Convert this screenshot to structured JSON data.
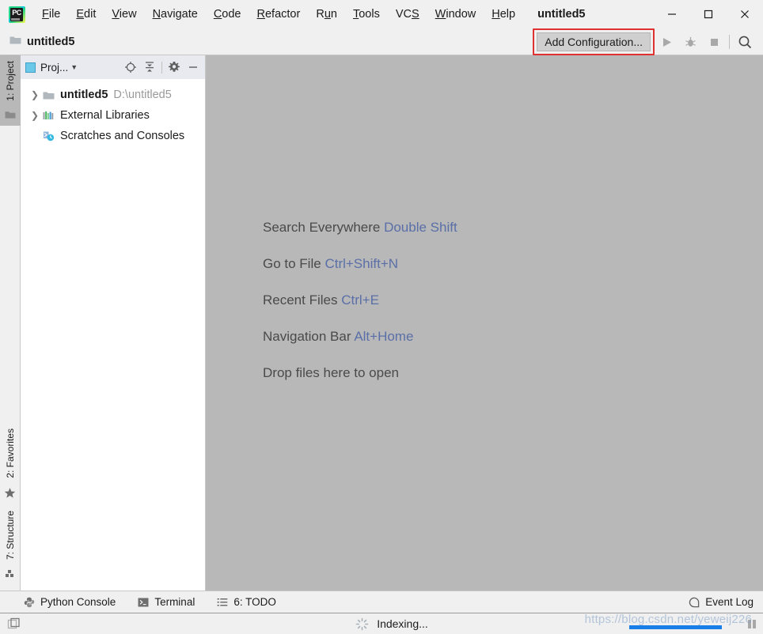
{
  "window": {
    "title": "untitled5",
    "logo_text": "PC",
    "controls": [
      {
        "name": "minimize",
        "glyph": "minimize-icon"
      },
      {
        "name": "maximize",
        "glyph": "maximize-icon"
      },
      {
        "name": "close",
        "glyph": "close-icon"
      }
    ]
  },
  "menu": [
    {
      "label": "File",
      "mnemonic": "F"
    },
    {
      "label": "Edit",
      "mnemonic": "E"
    },
    {
      "label": "View",
      "mnemonic": "V"
    },
    {
      "label": "Navigate",
      "mnemonic": "N"
    },
    {
      "label": "Code",
      "mnemonic": "C"
    },
    {
      "label": "Refactor",
      "mnemonic": "R"
    },
    {
      "label": "Run",
      "mnemonic": "u"
    },
    {
      "label": "Tools",
      "mnemonic": "T"
    },
    {
      "label": "VCS",
      "mnemonic": "S"
    },
    {
      "label": "Window",
      "mnemonic": "W"
    },
    {
      "label": "Help",
      "mnemonic": "H"
    }
  ],
  "navbar": {
    "breadcrumb": "untitled5",
    "breadcrumb_icon": "folder-icon",
    "add_configuration_label": "Add Configuration...",
    "highlight_color": "#e03131",
    "buttons": [
      {
        "name": "run-button",
        "icon": "play-icon",
        "enabled": false
      },
      {
        "name": "debug-button",
        "icon": "bug-icon",
        "enabled": false
      },
      {
        "name": "stop-button",
        "icon": "stop-icon",
        "enabled": false
      },
      {
        "name": "search-button",
        "icon": "search-icon",
        "enabled": true
      }
    ]
  },
  "left_strip": {
    "top_tabs": [
      {
        "label": "1: Project",
        "icon": "folder-icon",
        "active": true
      }
    ],
    "bottom_tabs": [
      {
        "label": "2: Favorites",
        "icon": "star-icon",
        "active": false
      },
      {
        "label": "7: Structure",
        "icon": "structure-icon",
        "active": false
      }
    ]
  },
  "project_panel": {
    "title": "Proj...",
    "title_icon": "project-view-icon",
    "tools": [
      {
        "name": "scroll-from-source-button",
        "icon": "target-icon"
      },
      {
        "name": "collapse-all-button",
        "icon": "collapse-icon"
      },
      {
        "name": "settings-button",
        "icon": "gear-icon"
      },
      {
        "name": "hide-button",
        "icon": "minus-icon"
      }
    ],
    "tree": [
      {
        "label": "untitled5",
        "path": "D:\\untitled5",
        "icon": "folder-icon",
        "expandable": true,
        "bold": true,
        "indent": 0
      },
      {
        "label": "External Libraries",
        "path": "",
        "icon": "library-icon",
        "expandable": true,
        "bold": false,
        "indent": 0
      },
      {
        "label": "Scratches and Consoles",
        "path": "",
        "icon": "scratches-icon",
        "expandable": false,
        "bold": false,
        "indent": 0
      }
    ]
  },
  "editor": {
    "background_color": "#b8b8b8",
    "hints": [
      {
        "action": "Search Everywhere",
        "shortcut": "Double Shift"
      },
      {
        "action": "Go to File",
        "shortcut": "Ctrl+Shift+N"
      },
      {
        "action": "Recent Files",
        "shortcut": "Ctrl+E"
      },
      {
        "action": "Navigation Bar",
        "shortcut": "Alt+Home"
      },
      {
        "action": "Drop files here to open",
        "shortcut": ""
      }
    ],
    "shortcut_color": "#5a6fa8"
  },
  "bottom_bar": {
    "items": [
      {
        "label": "Python Console",
        "icon": "python-icon"
      },
      {
        "label": "Terminal",
        "icon": "terminal-icon"
      },
      {
        "label": "6: TODO",
        "icon": "todo-icon"
      }
    ],
    "event_log": {
      "label": "Event Log",
      "icon": "event-log-icon"
    }
  },
  "status_bar": {
    "left_icon": "layout-icon",
    "message": "Indexing...",
    "spinner_icon": "spinner-icon",
    "progress_percent": 100,
    "progress_color": "#1a7ee8",
    "pause_icon": "pause-icon"
  },
  "watermark": "https://blog.csdn.net/yeweij226"
}
